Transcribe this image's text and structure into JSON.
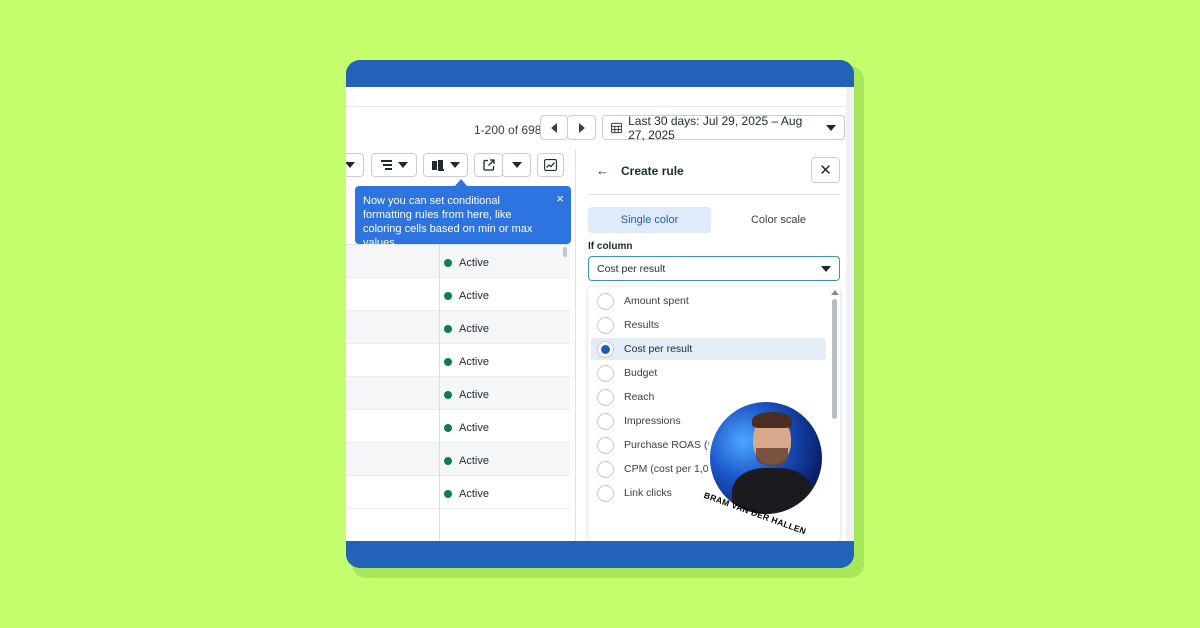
{
  "colors": {
    "background": "#c6ff6e",
    "band": "#2262b8",
    "tooltip": "#2d74e0",
    "status_active": "#0f7a55",
    "accent": "#1a5fb4"
  },
  "toolbar": {
    "pagination": "1-200 of 698",
    "prev_icon": "triangle-left-icon",
    "next_icon": "triangle-right-icon",
    "date_range": "Last 30 days: Jul 29, 2025 – Aug 27, 2025"
  },
  "tooltip": {
    "text": "Now you can set conditional formatting rules from here, like coloring cells based on min or max values.",
    "close": "×"
  },
  "table": {
    "rows": [
      {
        "status": "Active"
      },
      {
        "status": "Active"
      },
      {
        "status": "Active"
      },
      {
        "status": "Active"
      },
      {
        "status": "Active"
      },
      {
        "status": "Active"
      },
      {
        "status": "Active"
      },
      {
        "status": "Active"
      }
    ]
  },
  "panel": {
    "back": "←",
    "title": "Create rule",
    "close": "✕",
    "tabs": [
      "Single color",
      "Color scale"
    ],
    "if_column_label": "If column",
    "selected_column": "Cost per result",
    "options": [
      {
        "label": "Amount spent",
        "selected": false
      },
      {
        "label": "Results",
        "selected": false
      },
      {
        "label": "Cost per result",
        "selected": true
      },
      {
        "label": "Budget",
        "selected": false
      },
      {
        "label": "Reach",
        "selected": false
      },
      {
        "label": "Impressions",
        "selected": false
      },
      {
        "label": "Purchase ROAS (re",
        "selected": false
      },
      {
        "label": "CPM (cost per 1,000",
        "selected": false
      },
      {
        "label": "Link clicks",
        "selected": false
      }
    ]
  },
  "avatar": {
    "name": "BRAM VAN DER HALLEN"
  }
}
